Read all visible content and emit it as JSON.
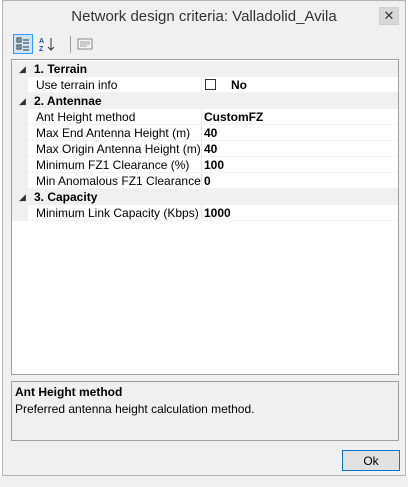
{
  "window": {
    "title": "Network design criteria: Valladolid_Avila"
  },
  "toolbar": {
    "buttons": [
      {
        "name": "categorized-icon",
        "active": true
      },
      {
        "name": "alphabetical-icon",
        "active": false
      },
      {
        "name": "property-pages-icon",
        "active": false
      }
    ]
  },
  "grid": {
    "categories": [
      {
        "label": "1. Terrain",
        "properties": [
          {
            "name": "Use terrain info",
            "value": "No",
            "checkbox": true,
            "checked": false
          }
        ]
      },
      {
        "label": "2. Antennae",
        "properties": [
          {
            "name": "Ant Height method",
            "value": "CustomFZ"
          },
          {
            "name": "Max End Antenna Height (m)",
            "value": "40"
          },
          {
            "name": "Max Origin Antenna Height (m)",
            "value": "40"
          },
          {
            "name": "Minimum FZ1 Clearance (%)",
            "value": "100"
          },
          {
            "name": "Min Anomalous FZ1 Clearance (",
            "value": "0"
          }
        ]
      },
      {
        "label": "3. Capacity",
        "properties": [
          {
            "name": "Minimum Link Capacity (Kbps)",
            "value": "1000"
          }
        ]
      }
    ]
  },
  "description": {
    "title": "Ant Height method",
    "text": "Preferred antenna height calculation method."
  },
  "buttons": {
    "ok_label": "Ok"
  },
  "colors": {
    "selection": "#cce4f7",
    "focus_border": "#0078d7",
    "panel": "#f0f0f0"
  }
}
